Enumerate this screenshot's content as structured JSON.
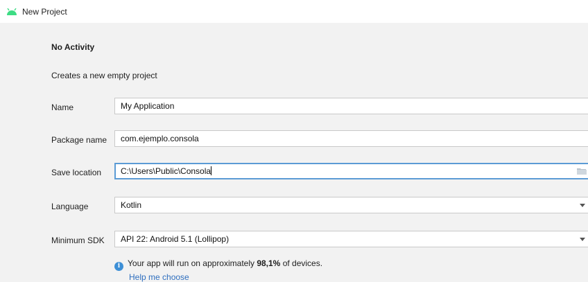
{
  "window": {
    "title": "New Project"
  },
  "template": {
    "name": "No Activity",
    "description": "Creates a new empty project"
  },
  "form": {
    "name": {
      "label": "Name",
      "value": "My Application"
    },
    "package_name": {
      "label": "Package name",
      "value": "com.ejemplo.consola"
    },
    "save_location": {
      "label": "Save location",
      "value": "C:\\Users\\Public\\Consola",
      "icon": "folder-icon"
    },
    "language": {
      "label": "Language",
      "value": "Kotlin"
    },
    "minimum_sdk": {
      "label": "Minimum SDK",
      "value": "API 22: Android 5.1 (Lollipop)"
    }
  },
  "info": {
    "text_before": "Your app will run on approximately ",
    "percent": "98,1%",
    "text_after": " of devices.",
    "help_link": "Help me choose"
  },
  "colors": {
    "accent": "#5b9bd5",
    "link": "#2f6fbf",
    "android_green": "#3ddc84",
    "info_icon": "#3d8fd6"
  }
}
